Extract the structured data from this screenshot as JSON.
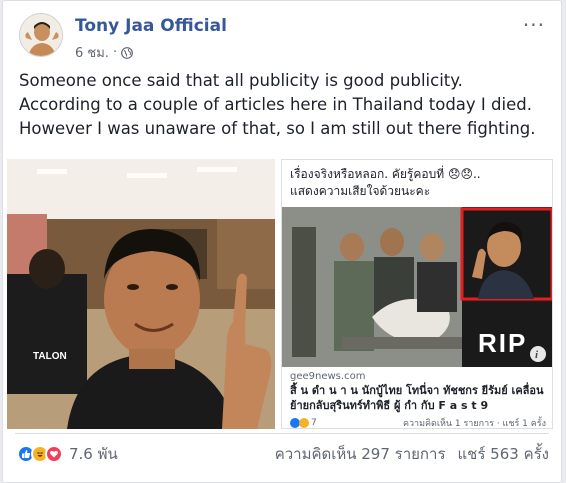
{
  "post": {
    "author": "Tony Jaa Official",
    "time": "6 ชม.",
    "separator": "·",
    "lines": [
      "Someone once said that all publicity is good publicity.",
      "According to a couple of articles here in Thailand today I died.",
      "However I was unaware of that, so I am still out there fighting."
    ]
  },
  "photo": {
    "shirt_text": "TALON"
  },
  "shared": {
    "headline_line1": "เรื่องจริงหรือหลอก. คัยรู้คอบที่ 😞😞..",
    "headline_line2": "แสดงความเสียใจด้วยนะคะ",
    "rip_text": "RIP",
    "domain": "gee9news.com",
    "title_line1": "สิ้ น ดำ น า น นักบู้ไทย โทนี่จา ทัชชกร ยีรัมย์ เคลื่อน",
    "title_line2": "ย้ายกลับสุรินทร์ทำพิธี ผู้ กำ กับ F a s t 9",
    "reaction_count": "7",
    "stats": "ความคิดเห็น 1 รายการ · แชร์ 1 ครั้ง"
  },
  "footer": {
    "reaction_count": "7.6 พัน",
    "comments": "ความคิดเห็น 297 รายการ",
    "shares": "แชร์ 563 ครั้ง"
  },
  "colors": {
    "link": "#365899",
    "like": "#1877f2",
    "love": "#f33e58",
    "haha": "#f7b125",
    "rip_frame": "#e41e1e"
  },
  "icons": [
    "globe-icon",
    "more-options-icon",
    "like-reaction-icon",
    "haha-reaction-icon",
    "love-reaction-icon",
    "info-icon",
    "sad-reaction-icon"
  ]
}
